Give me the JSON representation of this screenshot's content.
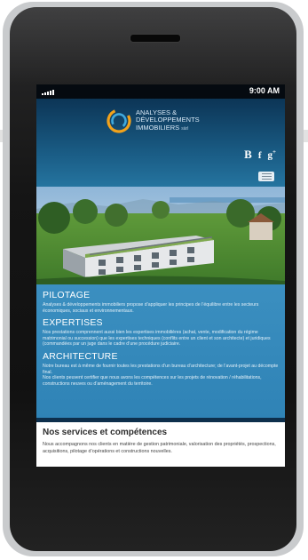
{
  "status": {
    "time": "9:00 AM"
  },
  "brand": {
    "line1": "ANALYSES &",
    "line2": "DÉVELOPPEMENTS",
    "line3": "IMMOBILIERS",
    "suffix": "sàrl"
  },
  "social": {
    "blog": "B",
    "facebook": "f",
    "google_plus": "g",
    "google_plus_sup": "+"
  },
  "sections": [
    {
      "title": "PILOTAGE",
      "text": "Analyses & développements immobiliers propose d’appliquer les principes de l’équilibre entre les secteurs économiques, sociaux et environnementaux."
    },
    {
      "title": "EXPERTISES",
      "text": "Nos prestations comprennent aussi bien les expertises immobilières (achat, vente, modification du régime matrimonial ou succession) que les expertises techniques (conflits entre un client et son architecte) et juridiques (commandées par un juge dans le cadre d’une procédure judiciaire."
    },
    {
      "title": "ARCHITECTURE",
      "text": "Notre bureau est à même de fournir toutes les prestations d’un bureau d’architecture; de l’avant-projet au décompte final.",
      "text2": "Nos clients peuvent certifier que nous avons les compétences sur les projets de rénovation / réhabilitations, constructions neuves ou d’aménagement du territoire."
    }
  ],
  "services": {
    "title": "Nos services et compétences",
    "text": "Nous accompagnons nos clients en matière de gestion patrimoniale, valorisation des propriétés, prospections, acquisitions, pilotage d’opérations et constructions nouvelles."
  },
  "colors": {
    "header_top": "#0c3556",
    "content_blue": "#3b8fc0",
    "logo_orange": "#f2a21b",
    "logo_blue": "#3fa9de"
  }
}
